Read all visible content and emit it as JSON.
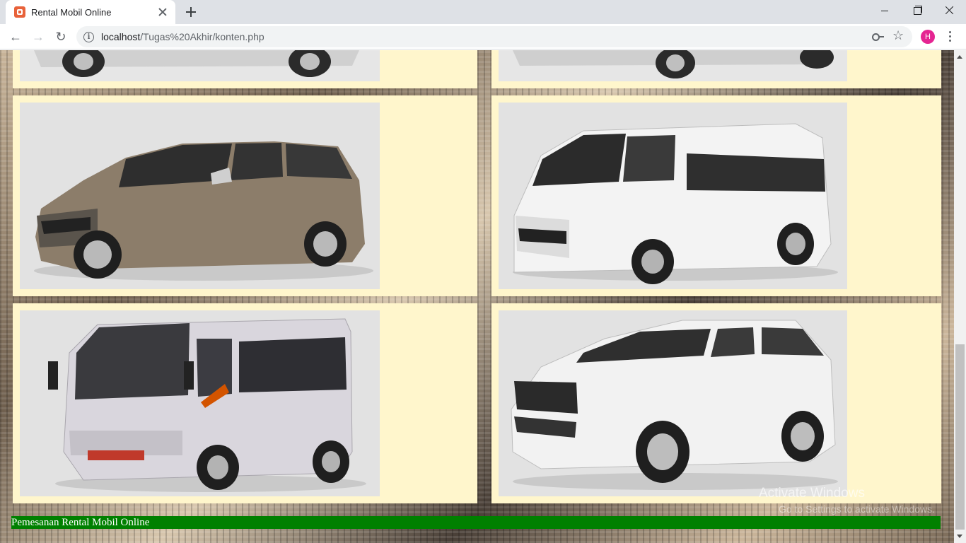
{
  "browser": {
    "tab_title": "Rental Mobil Online",
    "url_host": "localhost",
    "url_path": "/Tugas%20Akhir/konten.php",
    "avatar_letter": "H"
  },
  "cars": [
    {
      "name": "top-left-car"
    },
    {
      "name": "top-right-car"
    },
    {
      "name": "innova-mpv"
    },
    {
      "name": "hiace-van"
    },
    {
      "name": "elf-minibus"
    },
    {
      "name": "fortuner-suv"
    }
  ],
  "footer": {
    "text": "Pemesanan Rental Mobil Online"
  },
  "watermark": {
    "title": "Activate Windows",
    "subtitle": "Go to Settings to activate Windows."
  },
  "colors": {
    "card_bg": "#fff6cc",
    "footer_bg": "#008000",
    "photo_bg": "#dcdcdc"
  }
}
